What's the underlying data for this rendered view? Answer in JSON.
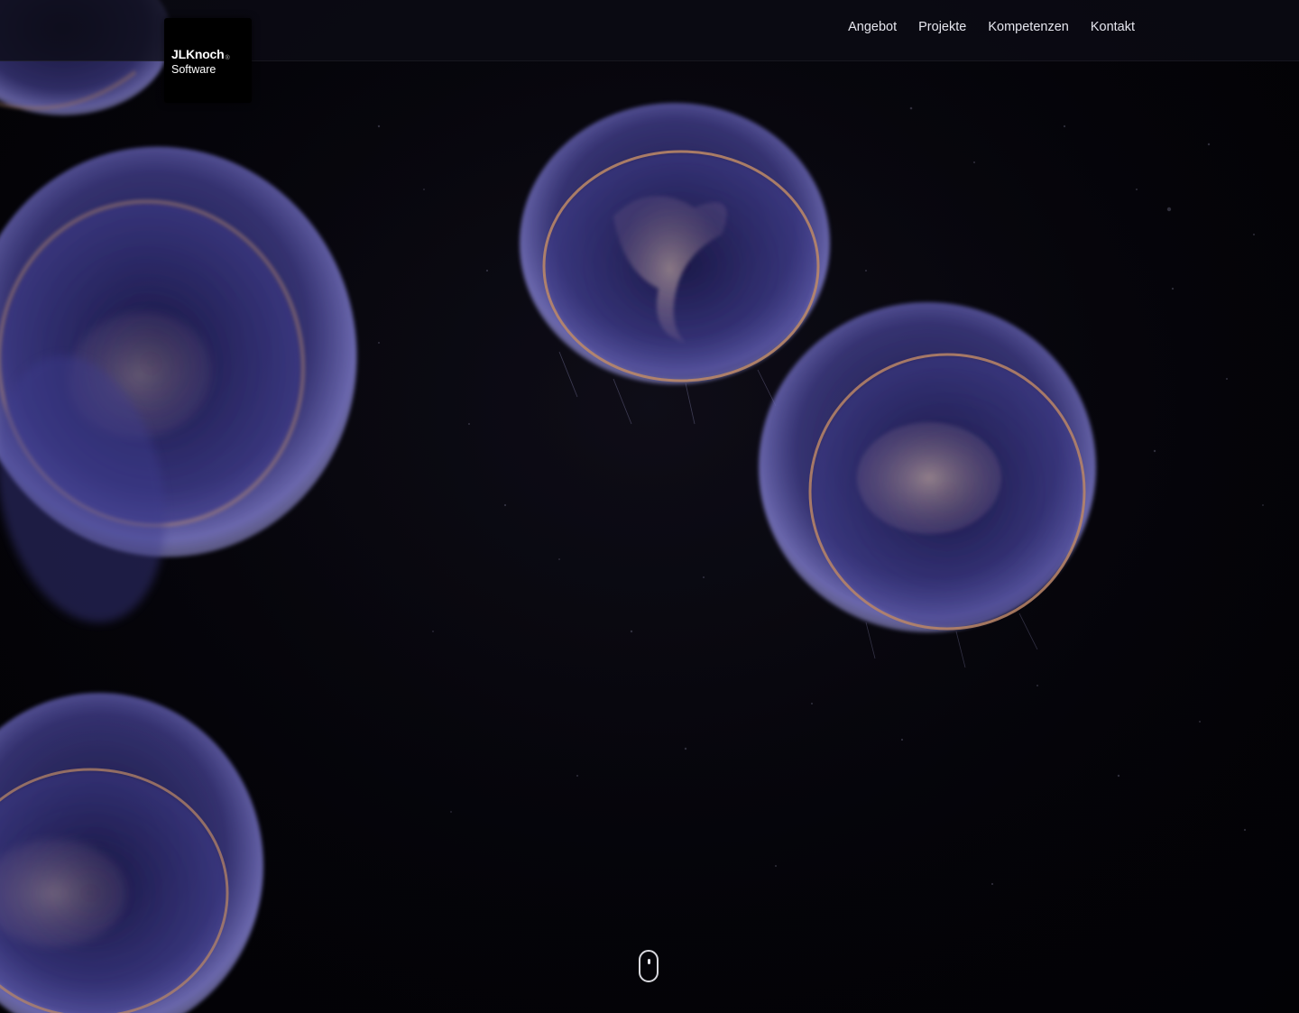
{
  "header": {
    "logo": {
      "name": "JLKnoch",
      "registered": "®",
      "subtitle": "Software"
    },
    "nav": [
      {
        "label": "Angebot"
      },
      {
        "label": "Projekte"
      },
      {
        "label": "Kompetenzen"
      },
      {
        "label": "Kontakt"
      }
    ]
  },
  "hero": {
    "background_image": "jellyfish",
    "scroll_hint_icon": "mouse-scroll-icon"
  },
  "colors": {
    "header_bg": "#0c0b14",
    "nav_text": "#e6e6ee",
    "jellyfish_bell": "#6a66c8",
    "jellyfish_rim": "#d89a6c"
  }
}
